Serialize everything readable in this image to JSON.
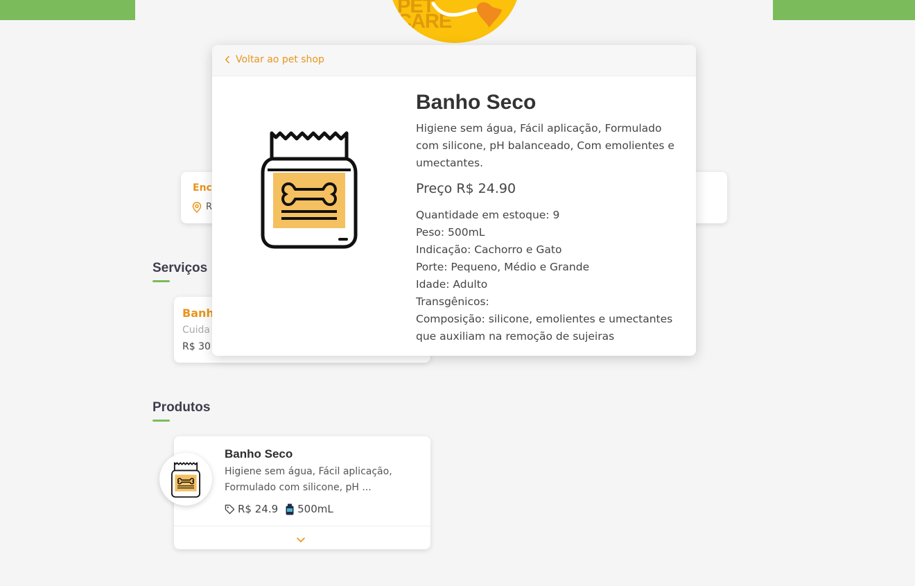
{
  "brand": {
    "logo_line1": "PET",
    "logo_line2": "CARE",
    "accent": "#7cbb5b",
    "orange": "#e8951c",
    "logo_bg": "#fbc10b"
  },
  "background_info": {
    "label": "Enc",
    "address": "R"
  },
  "sections": {
    "services_title": "Serviços",
    "products_title": "Produtos"
  },
  "service_card": {
    "name": "Banh",
    "desc": "Cuida",
    "price": "R$ 30"
  },
  "product_card": {
    "name": "Banho Seco",
    "desc": "Higiene sem água, Fácil aplicação, Formulado com silicone, pH ...",
    "price": "R$ 24.9",
    "size": "500mL",
    "icons": [
      "price-tag-icon",
      "bottle-icon",
      "chevron-down-icon"
    ]
  },
  "modal": {
    "back_label": "Voltar ao pet shop",
    "title": "Banho Seco",
    "description": "Higiene sem água, Fácil aplicação, Formulado com silicone, pH balanceado, Com emolientes e umectantes.",
    "price": "Preço R$ 24.90",
    "details": [
      "Quantidade em estoque: 9",
      "Peso: 500mL",
      "Indicação: Cachorro e Gato",
      "Porte: Pequeno, Médio e Grande",
      "Idade: Adulto",
      "Transgênicos:",
      "Composição: silicone, emolientes e umectantes que auxiliam na remoção de sujeiras"
    ]
  }
}
